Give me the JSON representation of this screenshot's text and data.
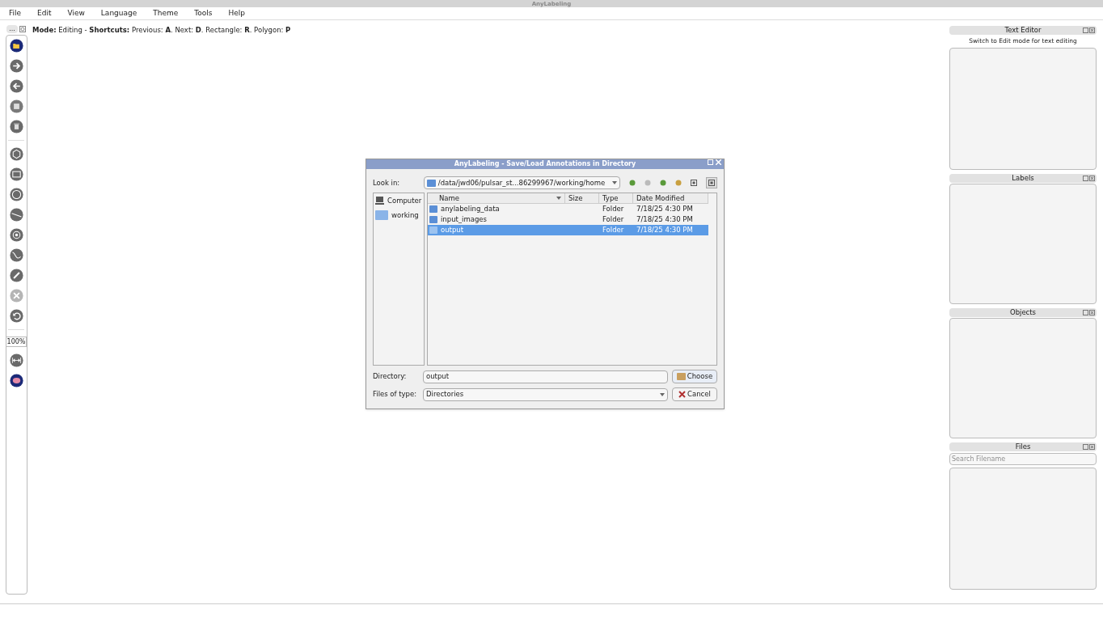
{
  "window": {
    "title": "AnyLabeling"
  },
  "menu": [
    "File",
    "Edit",
    "View",
    "Language",
    "Theme",
    "Tools",
    "Help"
  ],
  "toolbar_handle": "...",
  "status": "**Mode:** Editing - **Shortcuts:** Previous: **A**. Next: **D**. Rectangle: **R**. Polygon: **P**",
  "tools": [
    {
      "kind": "button",
      "disabled": false
    },
    {
      "kind": "button",
      "disabled": false
    },
    {
      "kind": "button",
      "disabled": false
    },
    {
      "kind": "button",
      "disabled": false
    },
    {
      "kind": "button",
      "disabled": false
    },
    {
      "kind": "separator"
    },
    {
      "kind": "button",
      "disabled": false
    },
    {
      "kind": "button",
      "disabled": false
    },
    {
      "kind": "button",
      "disabled": false
    },
    {
      "kind": "button",
      "disabled": false
    },
    {
      "kind": "button",
      "disabled": false
    },
    {
      "kind": "button",
      "disabled": false
    },
    {
      "kind": "button",
      "disabled": false
    },
    {
      "kind": "button",
      "disabled": true
    },
    {
      "kind": "button",
      "disabled": false
    },
    {
      "kind": "separator"
    },
    {
      "kind": "zoom",
      "value": "100%"
    },
    {
      "kind": "button",
      "disabled": false
    },
    {
      "kind": "button",
      "disabled": false
    }
  ],
  "dialog": {
    "title": "AnyLabeling - Save/Load Annotations in Directory",
    "look_in_label": "Look in:",
    "path": "/data/jwd06/pulsar_st...86299967/working/home",
    "places": [
      {
        "label": "Computer",
        "selected": false
      },
      {
        "label": "working",
        "selected": false
      }
    ],
    "columns": [
      "Name",
      "Size",
      "Type",
      "Date Modified"
    ],
    "rows": [
      {
        "name": "anylabeling_data",
        "size": "",
        "type": "Folder",
        "modified": "7/18/25 4:30 PM",
        "selected": false
      },
      {
        "name": "input_images",
        "size": "",
        "type": "Folder",
        "modified": "7/18/25 4:30 PM",
        "selected": false
      },
      {
        "name": "output",
        "size": "",
        "type": "Folder",
        "modified": "7/18/25 4:30 PM",
        "selected": true
      }
    ],
    "directory_label": "Directory:",
    "directory_value": "output",
    "choose_button": "Choose",
    "type_label": "Files of type:",
    "type_value": "Directories",
    "cancel_button": "Cancel"
  },
  "docks": [
    {
      "title": "Text Editor",
      "hint": "Switch to Edit mode for text editing"
    },
    {
      "title": "Labels"
    },
    {
      "title": "Objects"
    },
    {
      "title": "Files",
      "search_placeholder": "Search Filename"
    }
  ]
}
